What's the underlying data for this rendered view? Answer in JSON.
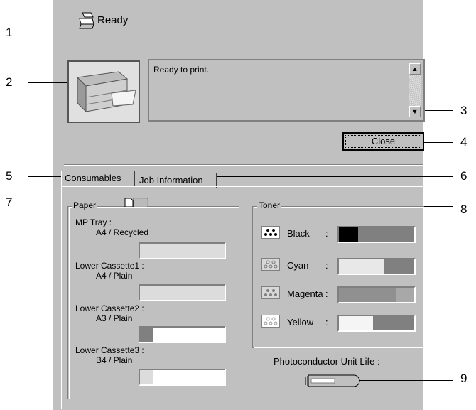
{
  "callouts": [
    "1",
    "2",
    "3",
    "4",
    "5",
    "6",
    "7",
    "8",
    "9"
  ],
  "status": {
    "text": "Ready",
    "icon": "printer-icon"
  },
  "message": {
    "text": "Ready to print."
  },
  "buttons": {
    "close": "Close"
  },
  "tabs": [
    {
      "label": "Consumables",
      "active": true
    },
    {
      "label": "Job Information",
      "active": false
    }
  ],
  "paper": {
    "group_label": "Paper",
    "trays": [
      {
        "name": "MP Tray :",
        "media": "A4 / Recycled",
        "level": 0
      },
      {
        "name": "Lower Cassette1 :",
        "media": "A4 / Plain",
        "level": 0
      },
      {
        "name": "Lower Cassette2 :",
        "media": "A3 / Plain",
        "level": 0.15
      },
      {
        "name": "Lower Cassette3 :",
        "media": "B4 / Plain",
        "level": 0.15
      }
    ]
  },
  "toner": {
    "group_label": "Toner",
    "items": [
      {
        "name": "Black",
        "level": 0.25,
        "color": "#000000"
      },
      {
        "name": "Cyan",
        "level": 0.6,
        "color": "#e8e8e8"
      },
      {
        "name": "Magenta",
        "level": 0.75,
        "color": "#909090"
      },
      {
        "name": "Yellow",
        "level": 0.45,
        "color": "#f5f5f5"
      }
    ]
  },
  "photoconductor": {
    "label": "Photoconductor Unit Life :",
    "level": 0.55
  }
}
